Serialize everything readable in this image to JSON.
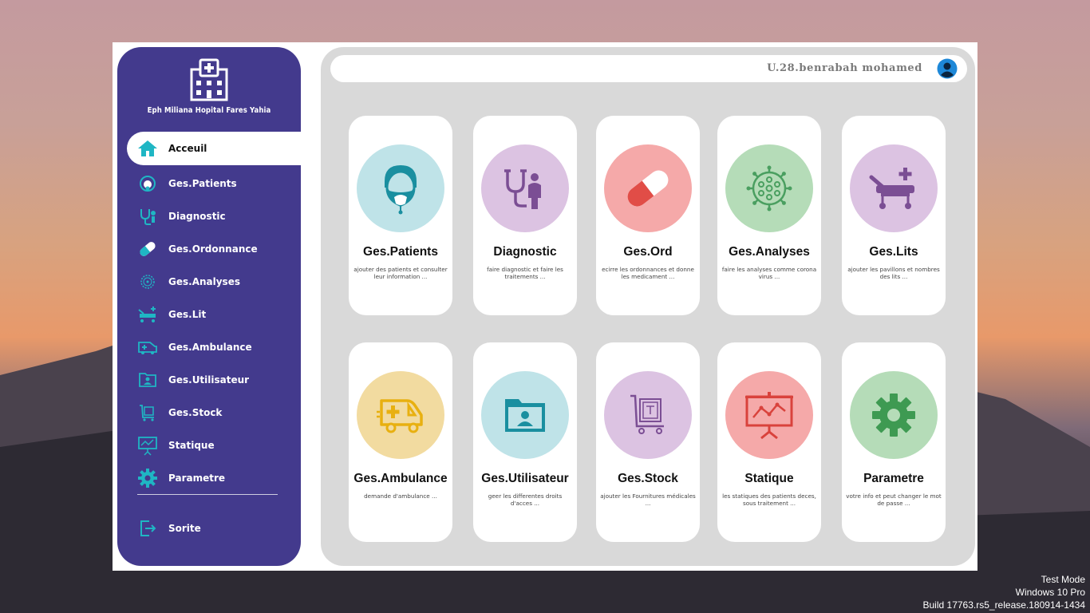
{
  "hospital": {
    "name": "Eph Miliana Hopital Fares Yahia"
  },
  "header": {
    "user_name": "U.28.benrabah mohamed"
  },
  "sidebar": {
    "items": [
      {
        "label": "Acceuil",
        "icon": "home-icon",
        "active": true
      },
      {
        "label": "Ges.Patients",
        "icon": "patient-icon"
      },
      {
        "label": "Diagnostic",
        "icon": "stethoscope-icon"
      },
      {
        "label": "Ges.Ordonnance",
        "icon": "pill-icon"
      },
      {
        "label": "Ges.Analyses",
        "icon": "virus-icon"
      },
      {
        "label": "Ges.Lit",
        "icon": "hospital-bed-icon"
      },
      {
        "label": "Ges.Ambulance",
        "icon": "ambulance-icon"
      },
      {
        "label": "Ges.Utilisateur",
        "icon": "user-folder-icon"
      },
      {
        "label": "Ges.Stock",
        "icon": "stock-cart-icon"
      },
      {
        "label": "Statique",
        "icon": "presentation-chart-icon"
      },
      {
        "label": "Parametre",
        "icon": "gear-icon"
      }
    ],
    "exit_label": "Sorite"
  },
  "cards": [
    {
      "title": "Ges.Patients",
      "desc": "ajouter des patients et consulter leur information ...",
      "icon": "patient-icon",
      "color": "#bfe3e8"
    },
    {
      "title": "Diagnostic",
      "desc": "faire diagnostic et faire les traitements ...",
      "icon": "stethoscope-icon",
      "color": "#dcc3e2"
    },
    {
      "title": "Ges.Ord",
      "desc": "ecirre les ordonnances et donne les medicament ...",
      "icon": "pill-icon",
      "color": "#f5a9a9"
    },
    {
      "title": "Ges.Analyses",
      "desc": "faire les analyses comme corona virus ...",
      "icon": "virus-icon",
      "color": "#b5dcb8"
    },
    {
      "title": "Ges.Lits",
      "desc": "ajouter les pavillons et nombres des lits ...",
      "icon": "hospital-bed-icon",
      "color": "#dcc3e2"
    },
    {
      "title": "Ges.Ambulance",
      "desc": "demande d'ambulance ...",
      "icon": "ambulance-icon",
      "color": "#f2dba0"
    },
    {
      "title": "Ges.Utilisateur",
      "desc": "geer les differentes droits d'acces ...",
      "icon": "user-folder-icon",
      "color": "#bfe3e8"
    },
    {
      "title": "Ges.Stock",
      "desc": "ajouter les Fournitures médicales ...",
      "icon": "stock-cart-icon",
      "color": "#dcc3e2"
    },
    {
      "title": "Statique",
      "desc": "les statiques des patients deces, sous traitement ...",
      "icon": "presentation-chart-icon",
      "color": "#f5a9a9"
    },
    {
      "title": "Parametre",
      "desc": "votre info et peut changer le mot de passe ...",
      "icon": "gear-icon",
      "color": "#b5dcb8"
    }
  ],
  "watermark": {
    "line1": "Test Mode",
    "line2": "Windows 10 Pro",
    "line3": "Build 17763.rs5_release.180914-1434"
  },
  "colors": {
    "sidebar": "#433a8d",
    "accent": "#1fb6c4",
    "content_bg": "#d9d9d9"
  }
}
